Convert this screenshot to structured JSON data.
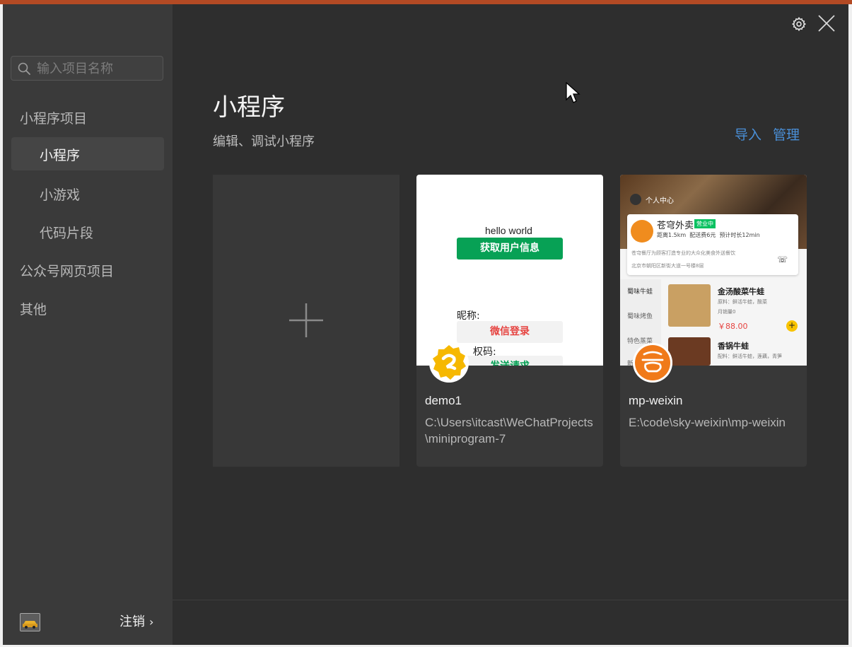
{
  "search": {
    "placeholder": "输入项目名称"
  },
  "sidebar": {
    "groups": [
      {
        "label": "小程序项目"
      },
      {
        "label": "公众号网页项目"
      },
      {
        "label": "其他"
      }
    ],
    "items": [
      {
        "label": "小程序",
        "active": true
      },
      {
        "label": "小游戏"
      },
      {
        "label": "代码片段"
      }
    ],
    "footer": {
      "logout_label": "注销",
      "chevron": "›"
    }
  },
  "main": {
    "title": "小程序",
    "subtitle": "编辑、调试小程序",
    "links": {
      "import": "导入",
      "manage": "管理"
    },
    "projects": [
      {
        "name": "demo1",
        "path": "C:\\Users\\itcast\\WeChatProjects\\miniprogram-7",
        "preview": {
          "hello": "hello world",
          "get_user_btn": "获取用户信息",
          "nickname_label": "昵称:",
          "wechat_login_btn": "微信登录",
          "auth_code_label": "权码:",
          "send_btn": "发送请求"
        }
      },
      {
        "name": "mp-weixin",
        "path": "E:\\code\\sky-weixin\\mp-weixin",
        "preview": {
          "personal_center": "个人中心",
          "shop_name": "苍穹外卖",
          "status_badge": "营业中",
          "distance": "距离1.5km",
          "delivery_fee": "配送费6元",
          "eta": "预计时长12min",
          "desc": "苍穹餐厅为顾客打造专业的大众化美食外送餐饮",
          "address": "北京市朝阳区新街大道一号楼8层",
          "categories": [
            "蜀味牛蛙",
            "蜀味烤鱼",
            "特色蒸菜",
            "新"
          ],
          "dishes": [
            {
              "name": "金汤酸菜牛蛙",
              "desc": "原料：鲜活牛蛙，酸菜",
              "sales": "月销量0",
              "price": "￥88.00"
            },
            {
              "name": "香锅牛蛙",
              "desc": "配料：鲜活牛蛙，莲藕，青笋"
            }
          ]
        }
      }
    ]
  },
  "colors": {
    "accent_link": "#4a90d9",
    "wechat_green": "#07c160",
    "price_red": "#e64340"
  }
}
